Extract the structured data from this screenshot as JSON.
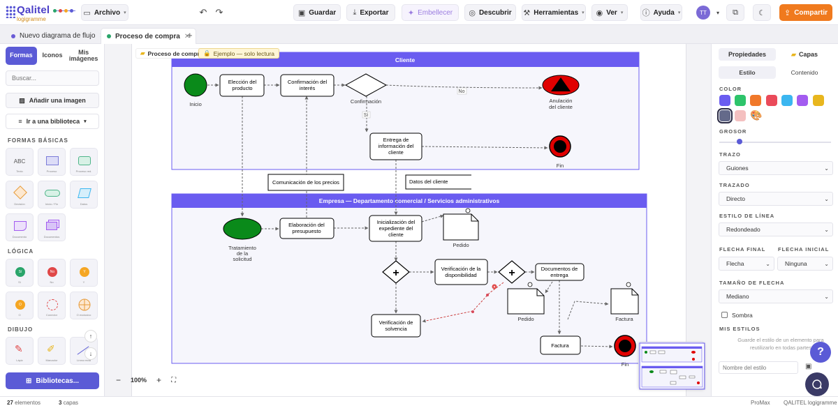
{
  "app": {
    "logo_name": "Qalitel",
    "logo_sub": "logigramme"
  },
  "toolbar": {
    "archivo": "Archivo",
    "guardar": "Guardar",
    "exportar": "Exportar",
    "embellecer": "Embellecer",
    "descubrir": "Descubrir",
    "herramientas": "Herramientas",
    "ver": "Ver",
    "ayuda": "Ayuda",
    "avatar": "TT",
    "compartir": "Compartir"
  },
  "tabs": [
    {
      "label": "Nuevo diagrama de flujo",
      "dot_color": "#6a5cd6"
    },
    {
      "label": "Proceso de compra",
      "dot_color": "#2aa56a"
    }
  ],
  "left": {
    "tabs": [
      "Formas",
      "Iconos",
      "Mis imágenes"
    ],
    "search_placeholder": "Buscar...",
    "add_image": "Añadir una imagen",
    "go_library": "Ir a una biblioteca",
    "sections": [
      "FORMAS BÁSICAS",
      "LÓGICA",
      "DIBUJO"
    ],
    "basic_shapes": [
      {
        "icon": "ABC",
        "label": "Texto"
      },
      {
        "icon": "rect",
        "label": "Proceso"
      },
      {
        "icon": "roundrect",
        "label": "Proceso red."
      },
      {
        "icon": "diamond",
        "label": "Decisión"
      },
      {
        "icon": "pill",
        "label": "Inicio / Fin"
      },
      {
        "icon": "parallelogram",
        "label": "Datos"
      },
      {
        "icon": "document",
        "label": "Documento"
      },
      {
        "icon": "multidoc",
        "label": "Documentos"
      }
    ],
    "logic_shapes": [
      {
        "icon": "Sí",
        "label": "Sí",
        "color": "#2aa56a"
      },
      {
        "icon": "No",
        "label": "No",
        "color": "#e04848"
      },
      {
        "icon": "Y",
        "label": "Y",
        "color": "#f5a623"
      },
      {
        "icon": "O",
        "label": "O",
        "color": "#f5a623"
      },
      {
        "icon": "dashed-circle",
        "label": "Conector"
      },
      {
        "icon": "cross-circle",
        "label": "O exclusivo"
      }
    ],
    "draw_tools": [
      {
        "icon": "pen",
        "label": "Lápiz"
      },
      {
        "icon": "marker",
        "label": "Marcador"
      },
      {
        "icon": "line",
        "label": "Línea recta"
      }
    ],
    "libraries_button": "Bibliotecas..."
  },
  "canvas": {
    "doc_chip": "Proceso de compra",
    "readonly_chip": "Ejemplo — solo lectura",
    "zoom": "100%"
  },
  "diagram": {
    "lane_client": "Cliente",
    "lane_company": "Empresa — Departamento comercial / Servicios administrativos",
    "inicio": "Inicio",
    "eleccion": [
      "Elección del",
      "producto"
    ],
    "confirmacion_interes": [
      "Confirmación del",
      "interés"
    ],
    "confirmacion": "Confirmación",
    "no": "No",
    "si": "Sí",
    "anulacion": [
      "Anulación",
      "del cliente"
    ],
    "entrega_info": [
      "Entrega de",
      "información del",
      "cliente"
    ],
    "fin": "Fin",
    "comunicacion": "Comunicación de los precios",
    "datos_cliente": "Datos del cliente",
    "tratamiento": [
      "Tratamiento",
      "de la",
      "solicitud"
    ],
    "elaboracion": [
      "Elaboración del",
      "presupuesto"
    ],
    "inicializacion": [
      "Inicialización del",
      "expediente del",
      "cliente"
    ],
    "pedido": "Pedido",
    "verif_disp": [
      "Verificación de la",
      "disponibilidad"
    ],
    "documentos": [
      "Documentos de",
      "entrega"
    ],
    "verif_solv": [
      "Verificación de",
      "solvencia"
    ],
    "factura": "Factura"
  },
  "right": {
    "tabs": [
      "Propiedades",
      "Capas"
    ],
    "subtabs": [
      "Estilo",
      "Contenido"
    ],
    "color_label": "COLOR",
    "colors": [
      "#6a5cf0",
      "#2ec46b",
      "#f0782a",
      "#ea4a5a",
      "#3bb6f0",
      "#a35cf0",
      "#e8b61e",
      "#646a8a",
      "#f4c0c0"
    ],
    "grosor_label": "GROSOR",
    "trazo_label": "TRAZO",
    "trazo_value": "Guiones",
    "trazado_label": "TRAZADO",
    "trazado_value": "Directo",
    "estilo_linea_label": "ESTILO DE LÍNEA",
    "estilo_linea_value": "Redondeado",
    "flecha_final_label": "FLECHA FINAL",
    "flecha_final_value": "Flecha",
    "flecha_inicial_label": "FLECHA INICIAL",
    "flecha_inicial_value": "Ninguna",
    "tamano_flecha_label": "TAMAÑO DE FLECHA",
    "tamano_flecha_value": "Mediano",
    "sombra_label": "Sombra",
    "mis_estilos_label": "MIS ESTILOS",
    "mis_estilos_hint": [
      "Guarde el estilo de un elemento para",
      "reutilizarlo en todas partes"
    ],
    "style_name_placeholder": "Nombre del estilo"
  },
  "status": {
    "elements_count": "27",
    "elements_label": "elementos",
    "layers_count": "3",
    "layers_label": "capas",
    "plan": "ProMax",
    "company": "QALITEL logigramme"
  }
}
